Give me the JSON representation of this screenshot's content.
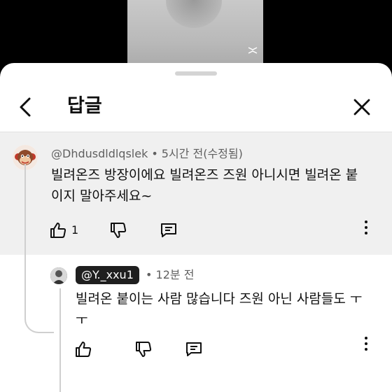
{
  "video": {
    "watermark_icon": "capcut-logo-icon"
  },
  "header": {
    "title": "답글",
    "back_icon": "back-arrow-icon",
    "close_icon": "close-icon"
  },
  "parent_comment": {
    "author": "@Dhdusdldlqslek",
    "time": "5시간 전(수정됨)",
    "separator": "•",
    "text": "빌려온즈 방장이에요 빌려온즈 즈원 아니시면 빌려온 붙이지 말아주세요~",
    "like_count": "1"
  },
  "reply": {
    "author": "@Y._xxu1",
    "separator": "•",
    "time": "12분 전",
    "text": "빌려온 붙이는 사람 많습니다 즈원 아닌 사람들도 ㅜㅜ"
  }
}
